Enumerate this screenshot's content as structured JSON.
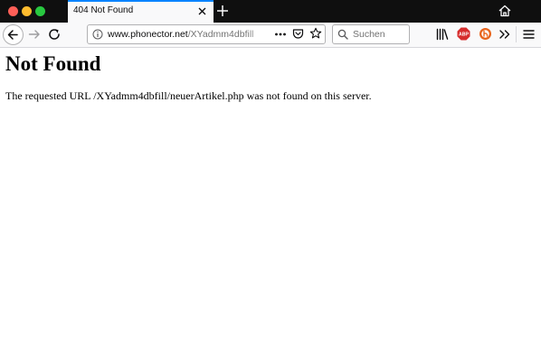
{
  "window": {
    "tab_title": "404 Not Found"
  },
  "toolbar": {
    "url_host": "www.phonector.net",
    "url_path": "/XYadmm4dbfill",
    "search_placeholder": "Suchen",
    "abp_label": "ABP"
  },
  "page": {
    "heading": "Not Found",
    "message": "The requested URL /XYadmm4dbfill/neuerArtikel.php was not found on this server."
  },
  "colors": {
    "tab_accent": "#0a84ff",
    "tabbar_bg": "#0f0f0f",
    "toolbar_bg": "#f9f9fa",
    "abp_red": "#d62d2d",
    "ext_orange": "#e8641b"
  },
  "icons": [
    "close-icon",
    "plus-icon",
    "home-icon",
    "back-arrow-icon",
    "forward-arrow-icon",
    "reload-icon",
    "info-icon",
    "more-dots-icon",
    "pocket-icon",
    "star-icon",
    "search-icon",
    "library-icon",
    "abp-icon",
    "extension-icon",
    "overflow-chevron-icon",
    "hamburger-menu-icon"
  ]
}
